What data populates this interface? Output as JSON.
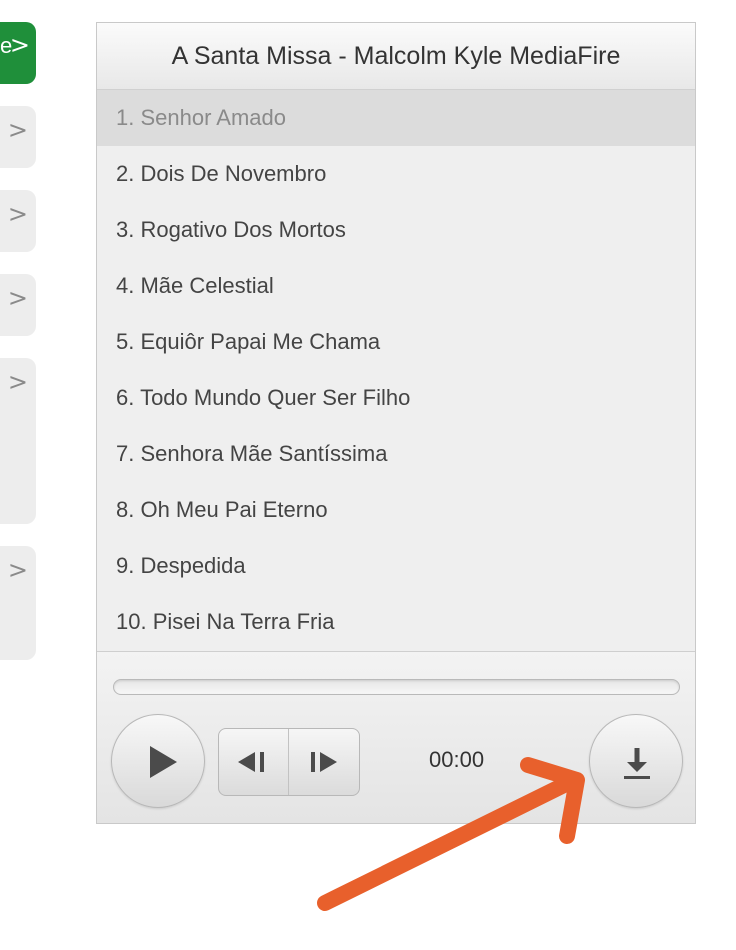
{
  "sidebar": {
    "active_label": "e",
    "chevron": ">",
    "items": [
      {
        "label": ""
      },
      {
        "label": ""
      },
      {
        "label": ""
      },
      {
        "label": ""
      },
      {
        "label": ""
      }
    ]
  },
  "player": {
    "title": "A Santa Missa - Malcolm Kyle MediaFire",
    "tracks": [
      "1. Senhor Amado",
      "2. Dois De Novembro",
      "3. Rogativo Dos Mortos",
      "4. Mãe Celestial",
      "5. Equiôr Papai Me Chama",
      "6. Todo Mundo Quer Ser Filho",
      "7. Senhora Mãe Santíssima",
      "8. Oh Meu Pai Eterno",
      "9. Despedida",
      "10. Pisei Na Terra Fria"
    ],
    "current_track_index": 0,
    "time": "00:00",
    "progress_fraction": 0,
    "icons": {
      "play": "play-icon",
      "previous": "skip-previous-icon",
      "next": "skip-next-icon",
      "download": "download-icon"
    }
  },
  "annotation": {
    "arrow_color": "#e8602c",
    "points_to": "download-button"
  },
  "colors": {
    "active_tab": "#1f8f3a",
    "current_track_bg": "#dcdcdc"
  }
}
